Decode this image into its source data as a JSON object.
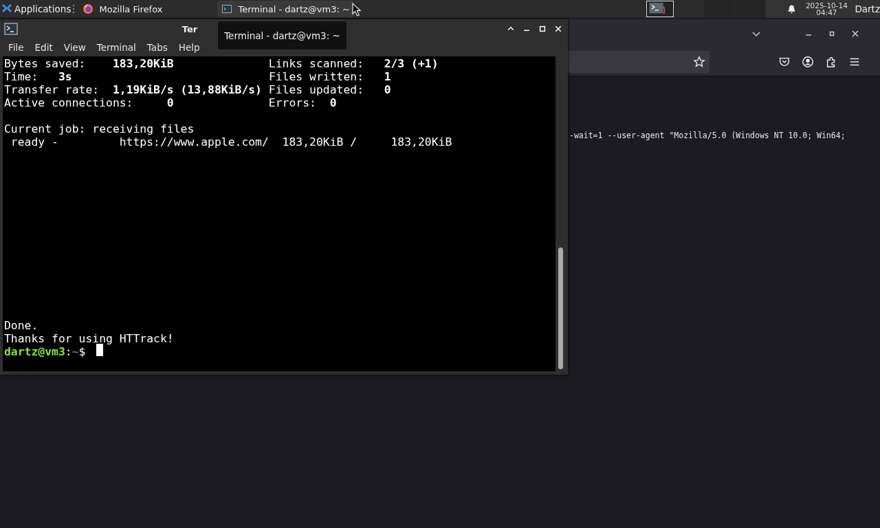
{
  "taskbar": {
    "menu_label": "Applications",
    "tasks": [
      {
        "label": "Mozilla Firefox",
        "kind": "firefox",
        "selected": false
      },
      {
        "label": "Terminal - dartz@vm3: ~",
        "kind": "terminal",
        "selected": true
      }
    ],
    "clock": {
      "date": "2025-10-14",
      "time": "04:47"
    },
    "user": "Dartz"
  },
  "browser": {
    "command_text": "-wait=1 --user-agent \"Mozilla/5.0 (Windows NT 10.0; Win64;"
  },
  "terminal": {
    "title": "Ter",
    "tooltip": "Terminal - dartz@vm3: ~",
    "menu": [
      "File",
      "Edit",
      "View",
      "Terminal",
      "Tabs",
      "Help"
    ],
    "groups": [
      [
        "Bytes saved:    **183,20KiB**              Links scanned:   **2/3 (+1)**",
        "Time:   **3s**                             Files written:   **1**",
        "Transfer rate:  **1,19KiB/s (13,88KiB/s)** Files updated:   **0**",
        "Active connections:     **0**              Errors:  **0**"
      ],
      [
        "Current job: receiving files",
        " ready -         https://www.apple.com/  183,20KiB /     183,20KiB"
      ],
      [
        "Done.",
        "Thanks for using HTTrack!"
      ]
    ],
    "prompt": {
      "user_host": "dartz@vm3",
      "separator": ":",
      "path": "~",
      "symbol": "$"
    }
  }
}
